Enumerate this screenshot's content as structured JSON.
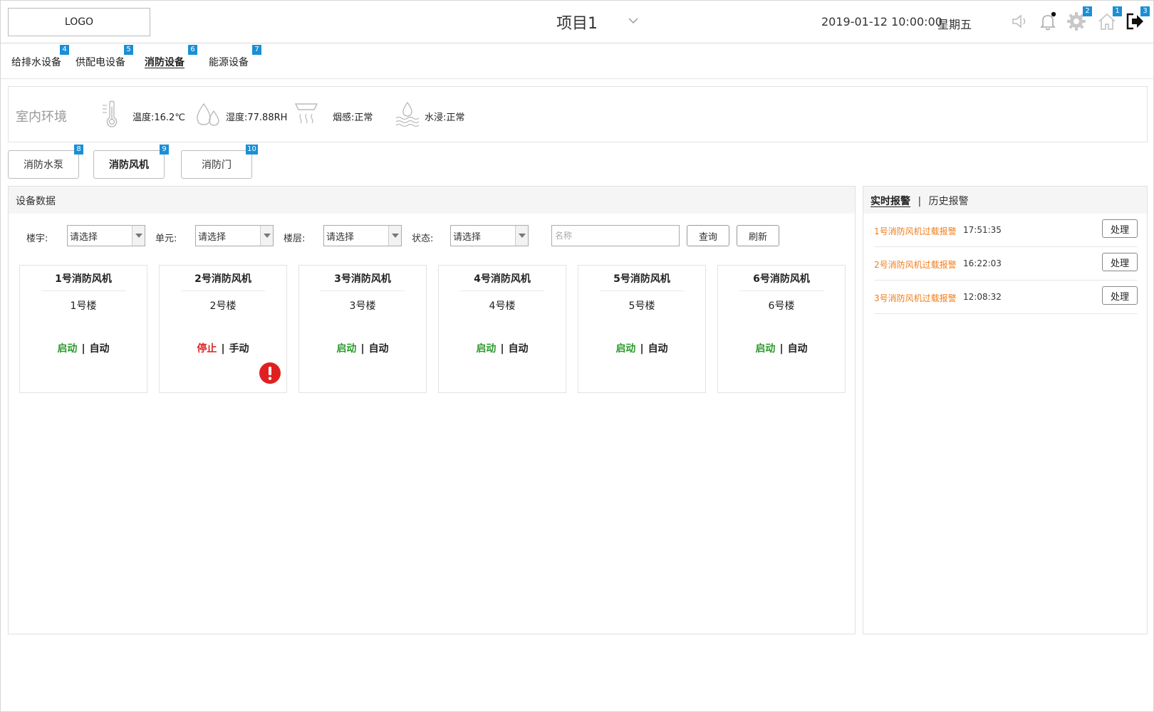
{
  "header": {
    "logo": "LOGO",
    "project": "项目1",
    "datetime": "2019-01-12 10:00:00",
    "weekday": "星期五",
    "icons": [
      "speaker-icon",
      "bell-icon",
      "gear-icon",
      "home-icon",
      "logout-icon"
    ],
    "badges": {
      "gear": "2",
      "home": "1",
      "logout": "3"
    }
  },
  "nav": {
    "items": [
      {
        "label": "给排水设备",
        "badge": "4"
      },
      {
        "label": "供配电设备",
        "badge": "5"
      },
      {
        "label": "消防设备",
        "badge": "6",
        "active": true
      },
      {
        "label": "能源设备",
        "badge": "7"
      }
    ]
  },
  "environment": {
    "title": "室内环境",
    "temperature": "温度:16.2℃",
    "humidity": "湿度:77.88RH",
    "smoke": "烟感:正常",
    "flood": "水浸:正常"
  },
  "subtabs": [
    {
      "label": "消防水泵",
      "badge": "8"
    },
    {
      "label": "消防风机",
      "badge": "9",
      "active": true
    },
    {
      "label": "消防门",
      "badge": "10"
    }
  ],
  "device_panel": {
    "title": "设备数据",
    "filters": {
      "building_label": "楼宇:",
      "unit_label": "单元:",
      "floor_label": "楼层:",
      "status_label": "状态:",
      "select_value": "请选择",
      "name_placeholder": "名称"
    },
    "query_label": "查询",
    "refresh_label": "刷新",
    "devices": [
      {
        "name": "1号消防风机",
        "building": "1号楼",
        "state": "启动",
        "mode": "自动",
        "alert": false
      },
      {
        "name": "2号消防风机",
        "building": "2号楼",
        "state": "停止",
        "mode": "手动",
        "alert": true
      },
      {
        "name": "3号消防风机",
        "building": "3号楼",
        "state": "启动",
        "mode": "自动",
        "alert": false
      },
      {
        "name": "4号消防风机",
        "building": "4号楼",
        "state": "启动",
        "mode": "自动",
        "alert": false
      },
      {
        "name": "5号消防风机",
        "building": "5号楼",
        "state": "启动",
        "mode": "自动",
        "alert": false
      },
      {
        "name": "6号消防风机",
        "building": "6号楼",
        "state": "启动",
        "mode": "自动",
        "alert": false
      }
    ],
    "separator": "|"
  },
  "alarm_panel": {
    "tab_realtime": "实时报警",
    "tab_separator": "|",
    "tab_history": "历史报警",
    "action_label": "处理",
    "alarms": [
      {
        "name": "1号消防风机过载报警",
        "time": "17:51:35"
      },
      {
        "name": "2号消防风机过载报警",
        "time": "16:22:03"
      },
      {
        "name": "3号消防风机过载报警",
        "time": "12:08:32"
      }
    ]
  },
  "colors": {
    "badge": "#1a8fd6",
    "running": "#2a9a2a",
    "stopped": "#e02020",
    "alarm_text": "#f07d19",
    "alert_icon": "#e02020"
  }
}
